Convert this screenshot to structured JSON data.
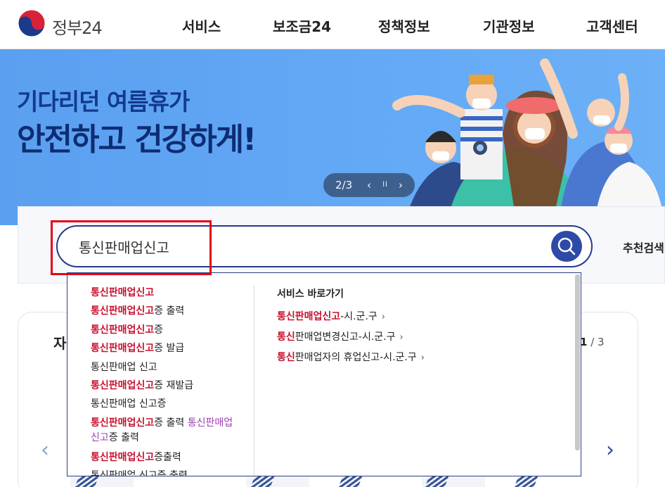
{
  "header": {
    "logo_text": "정부24",
    "nav": [
      "서비스",
      "보조금24",
      "정책정보",
      "기관정보",
      "고객센터"
    ]
  },
  "banner": {
    "line1": "기다리던 여름휴가",
    "line2": "안전하고 건강하게!",
    "pager": "2/3",
    "prev_icon": "‹",
    "pause_icon": "ll",
    "next_icon": "›"
  },
  "search": {
    "value": "통신판매업신고",
    "recommend_label": "추천검색"
  },
  "autocomplete": {
    "suggestions": [
      {
        "hl": "통신판매업신고",
        "rest": ""
      },
      {
        "hl": "통신판매업신고",
        "rest": "증 출력"
      },
      {
        "hl": "통신판매업신고",
        "rest": "증"
      },
      {
        "hl": "통신판매업신고",
        "rest": "증 발급"
      },
      {
        "hl": "",
        "rest": "통신판매업 신고"
      },
      {
        "hl": "통신판매업신고",
        "rest": "증 재발급"
      },
      {
        "hl": "",
        "rest": "통신판매업 신고증"
      },
      {
        "hl": "통신판매업신고",
        "rest": "증 출력 ",
        "extra_hl": "통신판매업",
        "line2_hl": "신고",
        "line2_rest": "증 출력"
      },
      {
        "hl": "통신판매업신고",
        "rest": "증출력"
      },
      {
        "hl": "",
        "rest": "통신판매업 신고증 출력"
      }
    ],
    "service_title": "서비스 바로가기",
    "service_links": [
      {
        "hl": "통신판매업신고",
        "rest": "-시.군.구"
      },
      {
        "hl": "통신",
        "rest": "판매업변경신고-시.군.구"
      },
      {
        "hl": "통신",
        "rest": "판매업자의 휴업신고-시.군.구"
      }
    ],
    "chevron": "›"
  },
  "lower": {
    "title": "자",
    "page_current": "1",
    "page_total": "/ 3",
    "left_arrow": "‹",
    "right_arrow": "›"
  },
  "colors": {
    "primary": "#2d4aa6",
    "highlight": "#c8102e",
    "annotation": "#e60012",
    "banner": "#62a8f5"
  }
}
